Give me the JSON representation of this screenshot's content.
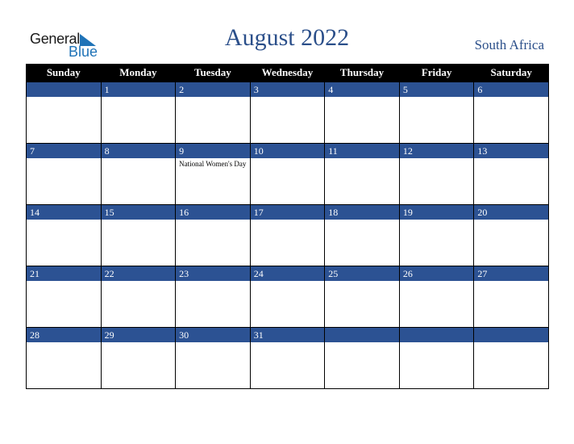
{
  "brand": {
    "line1": "General",
    "line2": "Blue"
  },
  "title": "August 2022",
  "country": "South Africa",
  "colors": {
    "accent": "#2c5293",
    "title": "#2b4f8a",
    "header_bg": "#000000"
  },
  "weekdays": [
    "Sunday",
    "Monday",
    "Tuesday",
    "Wednesday",
    "Thursday",
    "Friday",
    "Saturday"
  ],
  "weeks": [
    [
      {
        "day": "",
        "event": ""
      },
      {
        "day": "1",
        "event": ""
      },
      {
        "day": "2",
        "event": ""
      },
      {
        "day": "3",
        "event": ""
      },
      {
        "day": "4",
        "event": ""
      },
      {
        "day": "5",
        "event": ""
      },
      {
        "day": "6",
        "event": ""
      }
    ],
    [
      {
        "day": "7",
        "event": ""
      },
      {
        "day": "8",
        "event": ""
      },
      {
        "day": "9",
        "event": "National Women's Day"
      },
      {
        "day": "10",
        "event": ""
      },
      {
        "day": "11",
        "event": ""
      },
      {
        "day": "12",
        "event": ""
      },
      {
        "day": "13",
        "event": ""
      }
    ],
    [
      {
        "day": "14",
        "event": ""
      },
      {
        "day": "15",
        "event": ""
      },
      {
        "day": "16",
        "event": ""
      },
      {
        "day": "17",
        "event": ""
      },
      {
        "day": "18",
        "event": ""
      },
      {
        "day": "19",
        "event": ""
      },
      {
        "day": "20",
        "event": ""
      }
    ],
    [
      {
        "day": "21",
        "event": ""
      },
      {
        "day": "22",
        "event": ""
      },
      {
        "day": "23",
        "event": ""
      },
      {
        "day": "24",
        "event": ""
      },
      {
        "day": "25",
        "event": ""
      },
      {
        "day": "26",
        "event": ""
      },
      {
        "day": "27",
        "event": ""
      }
    ],
    [
      {
        "day": "28",
        "event": ""
      },
      {
        "day": "29",
        "event": ""
      },
      {
        "day": "30",
        "event": ""
      },
      {
        "day": "31",
        "event": ""
      },
      {
        "day": "",
        "event": ""
      },
      {
        "day": "",
        "event": ""
      },
      {
        "day": "",
        "event": ""
      }
    ]
  ]
}
